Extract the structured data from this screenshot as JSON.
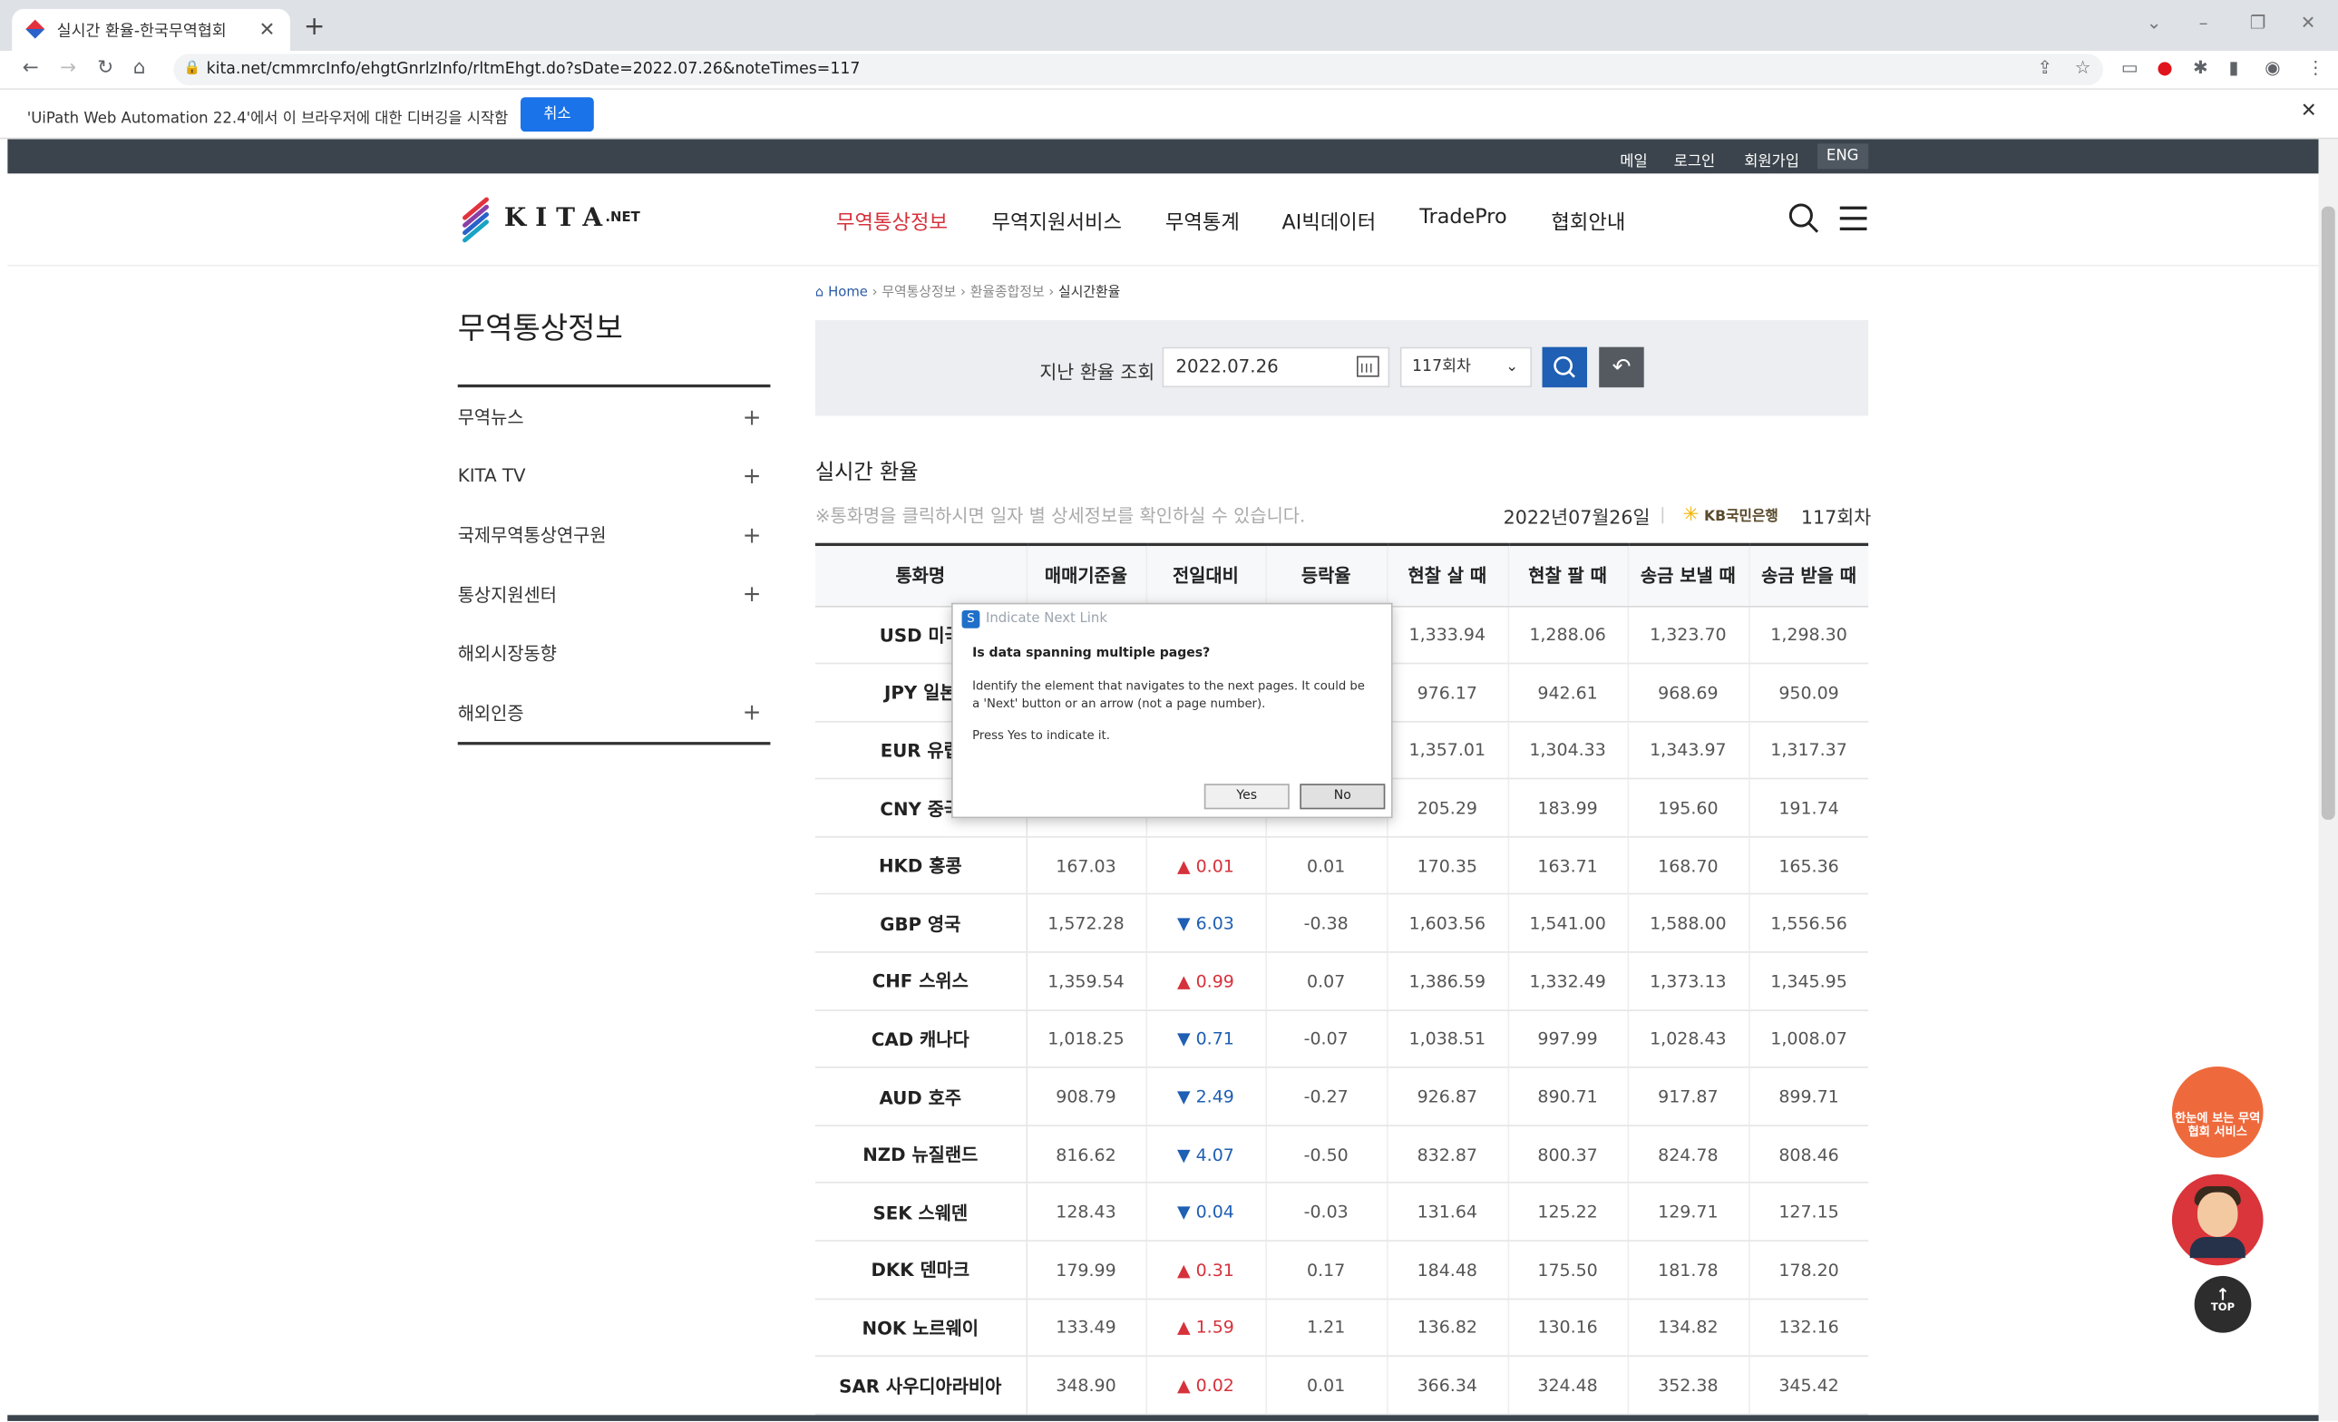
{
  "browser": {
    "tab_title": "실시간 환율-한국무역협회",
    "url": "kita.net/cmmrcInfo/ehgtGnrlzInfo/rltmEhgt.do?sDate=2022.07.26&noteTimes=117",
    "infobar_message": "'UiPath Web Automation 22.4'에서 이 브라우저에 대한 디버깅을 시작함",
    "infobar_cancel": "취소"
  },
  "topbar": {
    "mail": "메일",
    "login": "로그인",
    "signup": "회원가입",
    "eng": "ENG"
  },
  "header": {
    "logo_text": "KITA",
    "logo_suffix": ".NET",
    "menu": [
      "무역통상정보",
      "무역지원서비스",
      "무역통계",
      "AI빅데이터",
      "TradePro",
      "협회안내"
    ]
  },
  "sidebar": {
    "title": "무역통상정보",
    "items": [
      {
        "label": "무역뉴스",
        "expand": "+"
      },
      {
        "label": "KITA TV",
        "expand": "+"
      },
      {
        "label": "국제무역통상연구원",
        "expand": "+"
      },
      {
        "label": "통상지원센터",
        "expand": "+"
      },
      {
        "label": "해외시장동향",
        "expand": ""
      },
      {
        "label": "해외인증",
        "expand": "+"
      }
    ]
  },
  "breadcrumb": {
    "home": "Home",
    "level1": "무역통상정보",
    "level2": "환율종합정보",
    "current": "실시간환율"
  },
  "search": {
    "label": "지난 환율 조회",
    "date": "2022.07.26",
    "round": "117회차"
  },
  "section": {
    "title": "실시간 환율",
    "note": "※통화명을 클릭하시면 일자 별 상세정보를 확인하실 수 있습니다.",
    "as_of": "2022년07월26일",
    "bank": "KB국민은행",
    "round": "117회차"
  },
  "table": {
    "headers": [
      "통화명",
      "매매기준율",
      "전일대비",
      "등락율",
      "현찰 살 때",
      "현찰 팔 때",
      "송금 보낼 때",
      "송금 받을 때"
    ],
    "rows": [
      {
        "cur": "USD 미국",
        "base": "",
        "chg": "",
        "dir": "",
        "rate": "",
        "buy": "1,333.94",
        "sell": "1,288.06",
        "send": "1,323.70",
        "recv": "1,298.30"
      },
      {
        "cur": "JPY 일본",
        "base": "",
        "chg": "",
        "dir": "",
        "rate": "",
        "buy": "976.17",
        "sell": "942.61",
        "send": "968.69",
        "recv": "950.09"
      },
      {
        "cur": "EUR 유럽",
        "base": "",
        "chg": "",
        "dir": "",
        "rate": "",
        "buy": "1,357.01",
        "sell": "1,304.33",
        "send": "1,343.97",
        "recv": "1,317.37"
      },
      {
        "cur": "CNY 중국",
        "base": "",
        "chg": "",
        "dir": "",
        "rate": "",
        "buy": "205.29",
        "sell": "183.99",
        "send": "195.60",
        "recv": "191.74"
      },
      {
        "cur": "HKD 홍콩",
        "base": "167.03",
        "chg": "0.01",
        "dir": "up",
        "rate": "0.01",
        "buy": "170.35",
        "sell": "163.71",
        "send": "168.70",
        "recv": "165.36"
      },
      {
        "cur": "GBP 영국",
        "base": "1,572.28",
        "chg": "6.03",
        "dir": "down",
        "rate": "-0.38",
        "buy": "1,603.56",
        "sell": "1,541.00",
        "send": "1,588.00",
        "recv": "1,556.56"
      },
      {
        "cur": "CHF 스위스",
        "base": "1,359.54",
        "chg": "0.99",
        "dir": "up",
        "rate": "0.07",
        "buy": "1,386.59",
        "sell": "1,332.49",
        "send": "1,373.13",
        "recv": "1,345.95"
      },
      {
        "cur": "CAD 캐나다",
        "base": "1,018.25",
        "chg": "0.71",
        "dir": "down",
        "rate": "-0.07",
        "buy": "1,038.51",
        "sell": "997.99",
        "send": "1,028.43",
        "recv": "1,008.07"
      },
      {
        "cur": "AUD 호주",
        "base": "908.79",
        "chg": "2.49",
        "dir": "down",
        "rate": "-0.27",
        "buy": "926.87",
        "sell": "890.71",
        "send": "917.87",
        "recv": "899.71"
      },
      {
        "cur": "NZD 뉴질랜드",
        "base": "816.62",
        "chg": "4.07",
        "dir": "down",
        "rate": "-0.50",
        "buy": "832.87",
        "sell": "800.37",
        "send": "824.78",
        "recv": "808.46"
      },
      {
        "cur": "SEK 스웨덴",
        "base": "128.43",
        "chg": "0.04",
        "dir": "down",
        "rate": "-0.03",
        "buy": "131.64",
        "sell": "125.22",
        "send": "129.71",
        "recv": "127.15"
      },
      {
        "cur": "DKK 덴마크",
        "base": "179.99",
        "chg": "0.31",
        "dir": "up",
        "rate": "0.17",
        "buy": "184.48",
        "sell": "175.50",
        "send": "181.78",
        "recv": "178.20"
      },
      {
        "cur": "NOK 노르웨이",
        "base": "133.49",
        "chg": "1.59",
        "dir": "up",
        "rate": "1.21",
        "buy": "136.82",
        "sell": "130.16",
        "send": "134.82",
        "recv": "132.16"
      },
      {
        "cur": "SAR 사우디아라비아",
        "base": "348.90",
        "chg": "0.02",
        "dir": "up",
        "rate": "0.01",
        "buy": "366.34",
        "sell": "324.48",
        "send": "352.38",
        "recv": "345.42"
      }
    ]
  },
  "floating": {
    "service_label": "한눈에 보는 무역협회 서비스",
    "top_label": "TOP"
  },
  "dialog": {
    "title": "Indicate Next Link",
    "question": "Is data spanning multiple pages?",
    "body": "Identify the element that navigates to the next pages. It could be a 'Next' button or an arrow (not a page number).",
    "body2": "Press Yes to indicate it.",
    "yes": "Yes",
    "no": "No"
  },
  "colors": {
    "accent_red": "#d6323c",
    "accent_blue": "#1f5fb4",
    "topbar": "#3b444c"
  }
}
